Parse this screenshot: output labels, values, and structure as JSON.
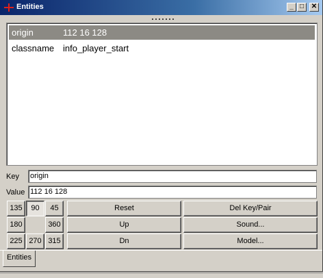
{
  "window": {
    "title": "Entities"
  },
  "entity_list": [
    {
      "key": "origin",
      "value": "112 16 128",
      "selected": true
    },
    {
      "key": "classname",
      "value": "info_player_start",
      "selected": false
    }
  ],
  "fields": {
    "key_label": "Key",
    "key_value": "origin",
    "value_label": "Value",
    "value_value": "112 16 128"
  },
  "angle_buttons": {
    "a135": "135",
    "a90": "90",
    "a45": "45",
    "a180": "180",
    "a360": "360",
    "a225": "225",
    "a270": "270",
    "a315": "315",
    "selected": "90"
  },
  "action_buttons": {
    "reset": "Reset",
    "up": "Up",
    "dn": "Dn",
    "del_key_pair": "Del Key/Pair",
    "sound": "Sound...",
    "model": "Model..."
  },
  "tabs": [
    {
      "label": "Entities",
      "active": true
    }
  ],
  "colors": {
    "titlebar": "#0a246a",
    "selection": "#8c8a84",
    "face": "#d4d0c8"
  },
  "icons": {
    "window_icon": "red-cross-icon",
    "minimize": "minimize-icon",
    "maximize": "maximize-icon",
    "close": "close-icon"
  }
}
